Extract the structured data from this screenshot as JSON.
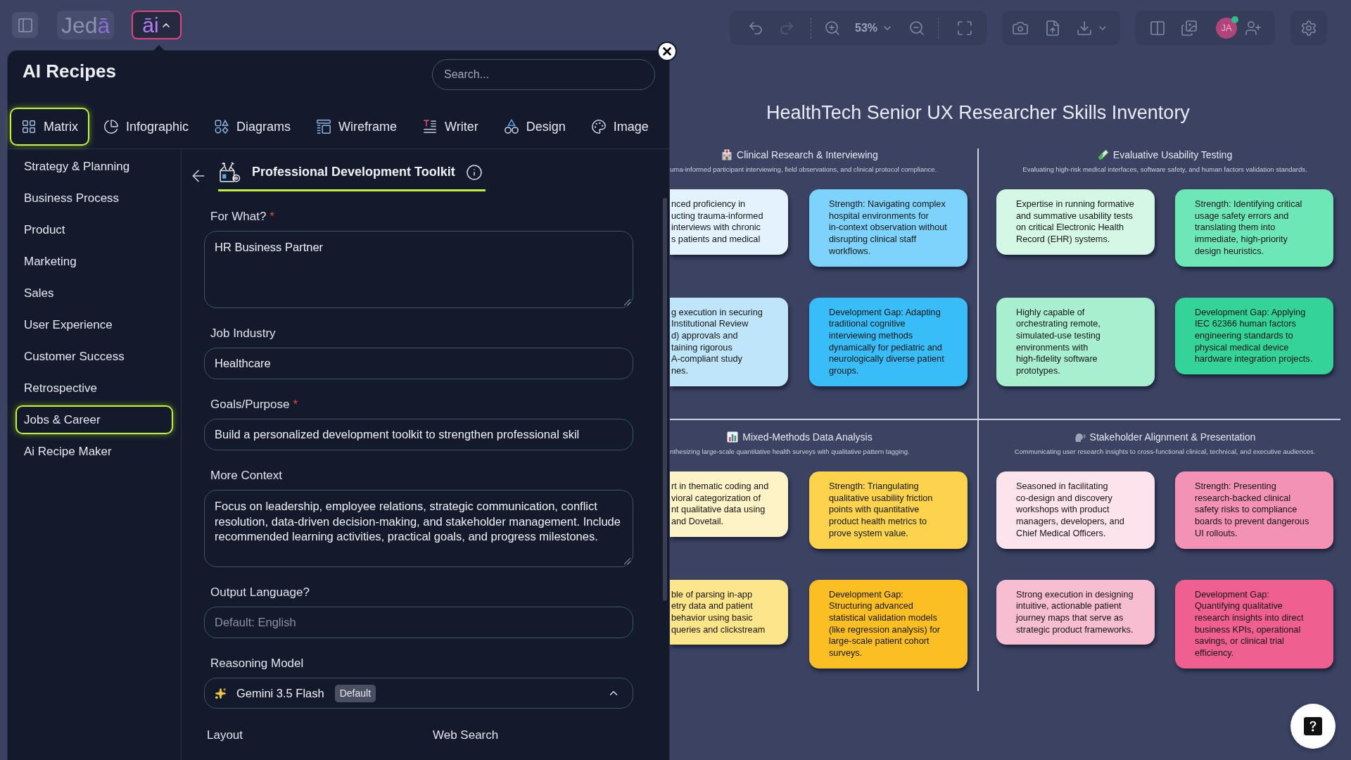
{
  "topbar": {
    "logo": {
      "text": "Jed",
      "accent": "ā"
    },
    "ai_button": {
      "label": "āi"
    },
    "history": [
      {
        "kind": "undo",
        "disabled": false
      },
      {
        "kind": "redo",
        "disabled": true
      }
    ],
    "zoom": "53%",
    "avatar": {
      "initials": "JA",
      "online": true
    }
  },
  "panel": {
    "title": "AI Recipes",
    "search": {
      "placeholder": "Search..."
    },
    "tabs": [
      {
        "label": "Matrix",
        "selected": true
      },
      {
        "label": "Infographic",
        "selected": false
      },
      {
        "label": "Diagrams",
        "selected": false
      },
      {
        "label": "Wireframe",
        "selected": false
      },
      {
        "label": "Writer",
        "selected": false
      },
      {
        "label": "Design",
        "selected": false
      },
      {
        "label": "Image",
        "selected": false
      }
    ],
    "categories": [
      {
        "label": "Strategy & Planning",
        "selected": false
      },
      {
        "label": "Business Process",
        "selected": false
      },
      {
        "label": "Product",
        "selected": false
      },
      {
        "label": "Marketing",
        "selected": false
      },
      {
        "label": "Sales",
        "selected": false
      },
      {
        "label": "User Experience",
        "selected": false
      },
      {
        "label": "Customer Success",
        "selected": false
      },
      {
        "label": "Retrospective",
        "selected": false
      },
      {
        "label": "Jobs & Career",
        "selected": true
      },
      {
        "label": "Ai Recipe Maker",
        "selected": false
      }
    ],
    "recipe": {
      "title": "Professional Development Toolkit",
      "fields": [
        {
          "kind": "textarea",
          "label": "For What?",
          "required_mark": "*",
          "value": "HR Business Partner"
        },
        {
          "kind": "input",
          "label": "Job Industry",
          "value": "Healthcare"
        },
        {
          "kind": "input",
          "label": "Goals/Purpose",
          "required_mark": "*",
          "value": "Build a personalized development toolkit to strengthen professional skil"
        },
        {
          "kind": "textarea",
          "label": "More Context",
          "value": "Focus on leadership, employee relations, strategic communication, conflict resolution, data-driven decision-making, and stakeholder management. Include recommended learning activities, practical goals, and progress milestones."
        },
        {
          "kind": "input",
          "label": "Output Language?",
          "placeholder": "Default: English"
        },
        {
          "kind": "select",
          "label": "Reasoning Model",
          "value": "Gemini 3.5 Flash",
          "badge": "Default"
        }
      ],
      "next_fields": [
        {
          "label": "Layout"
        },
        {
          "label": "Web Search"
        }
      ]
    }
  },
  "canvas": {
    "title": "HealthTech Senior UX Researcher Skills Inventory",
    "quadrants": [
      {
        "heading": "Clinical Research & Interviewing",
        "subtitle": "uma-informed participant interviewing, field observations, and clinical protocol compliance.",
        "cards": [
          {
            "text": "nced proficiency in\nucting trauma-informed\ninterviews with chronic\ns patients and medical",
            "color": "#e3f2fd"
          },
          {
            "text": "Strength: Navigating complex hospital environments for in-context observation without disrupting clinical staff workflows.",
            "color": "#7dd3fc"
          },
          {
            "text": "g execution in securing\nInstitutional Review\nd) approvals and\ntaining rigorous\nA-compliant study\nnes.",
            "color": "#bfe5fb"
          },
          {
            "text": "Development Gap: Adapting traditional cognitive interviewing methods dynamically for pediatric and neurologically diverse patient groups.",
            "color": "#38bdf8"
          }
        ]
      },
      {
        "heading": "Evaluative Usability Testing",
        "subtitle": "Evaluating high-risk medical interfaces, software safety, and human factors validation standards.",
        "cards": [
          {
            "text": "Expertise in running formative and summative usability tests on critical Electronic Health Record (EHR) systems.",
            "color": "#d4f7e6"
          },
          {
            "text": "Strength: Identifying critical usage safety errors and translating them into immediate, high-priority design heuristics.",
            "color": "#6ee7b7"
          },
          {
            "text": "Highly capable of orchestrating remote, simulated-use testing environments with high-fidelity software prototypes.",
            "color": "#a8efcf"
          },
          {
            "text": "Development Gap: Applying IEC 62366 human factors engineering standards to physical medical device hardware integration projects.",
            "color": "#34d399"
          }
        ]
      },
      {
        "heading": "Mixed-Methods Data Analysis",
        "subtitle": "nthesizing large-scale quantitative health surveys with qualitative pattern tagging.",
        "cards": [
          {
            "text": "rt in thematic coding and\nvioral categorization of\nnt qualitative data using\nand Dovetail.",
            "color": "#fef3c7"
          },
          {
            "text": "Strength: Triangulating qualitative usability friction points with quantitative product health metrics to prove system value.",
            "color": "#fcd34d"
          },
          {
            "text": "ble of parsing in-app\netry data and patient\nbehavior using basic\nqueries and clickstream",
            "color": "#fde68a"
          },
          {
            "text": "Development Gap: Structuring advanced statistical validation models (like regression analysis) for large-scale patient cohort surveys.",
            "color": "#fbbf24"
          }
        ]
      },
      {
        "heading": "Stakeholder Alignment & Presentation",
        "subtitle": "Communicating user research insights to cross-functional clinical, technical, and executive audiences.",
        "cards": [
          {
            "text": "Seasoned in facilitating co-design and discovery workshops with product managers, developers, and Chief Medical Officers.",
            "color": "#fde3ec"
          },
          {
            "text": "Strength: Presenting research-backed clinical safety risks to compliance boards to prevent dangerous UI rollouts.",
            "color": "#f492b5"
          },
          {
            "text": "Strong execution in designing intuitive, actionable patient journey maps that serve as strategic product frameworks.",
            "color": "#f7bdd1"
          },
          {
            "text": "Development Gap: Quantifying qualitative research insights into direct business KPIs, operational savings, or clinical trial efficiency.",
            "color": "#ef5f90"
          }
        ]
      }
    ]
  }
}
